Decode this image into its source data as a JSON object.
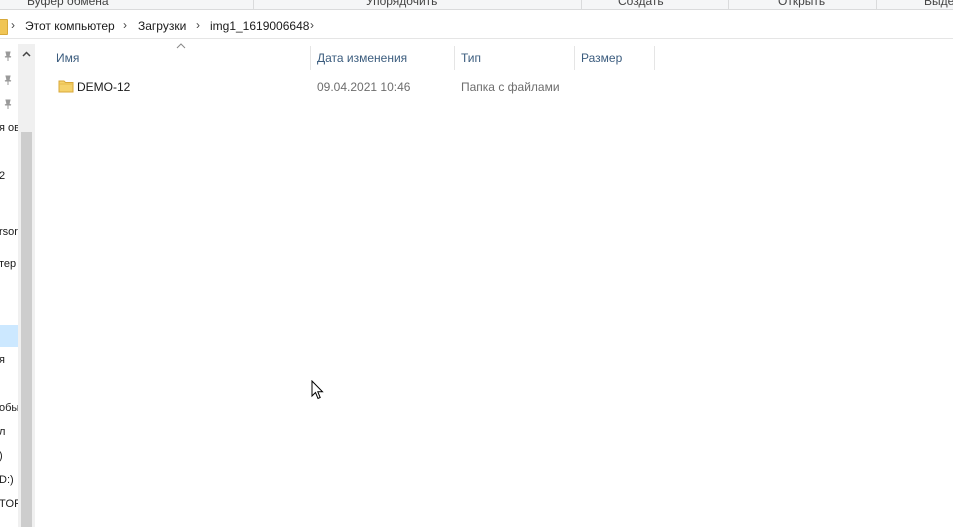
{
  "ribbon": {
    "groups": [
      "Буфер обмена",
      "Упорядочить",
      "Создать",
      "Открыть",
      "Выдел"
    ]
  },
  "address_bar": {
    "crumbs": [
      "Этот компьютер",
      "Загрузки",
      "img1_1619006648"
    ],
    "icon": "folder-icon"
  },
  "nav_pane": {
    "items": [
      "я ов",
      "2",
      "rsor",
      "тер",
      "я",
      "обы",
      "л",
      ")",
      "D:)",
      "TOP"
    ],
    "pin_icon": "pin-icon"
  },
  "columns": {
    "name": "Имя",
    "date": "Дата изменения",
    "type": "Тип",
    "size": "Размер"
  },
  "files": [
    {
      "name": "DEMO-12",
      "date": "09.04.2021 10:46",
      "type": "Папка с файлами",
      "size": "",
      "icon": "folder-icon"
    }
  ],
  "colors": {
    "header_text": "#3b5c7e",
    "folder": "#f0c555",
    "selection": "#cce8ff"
  }
}
